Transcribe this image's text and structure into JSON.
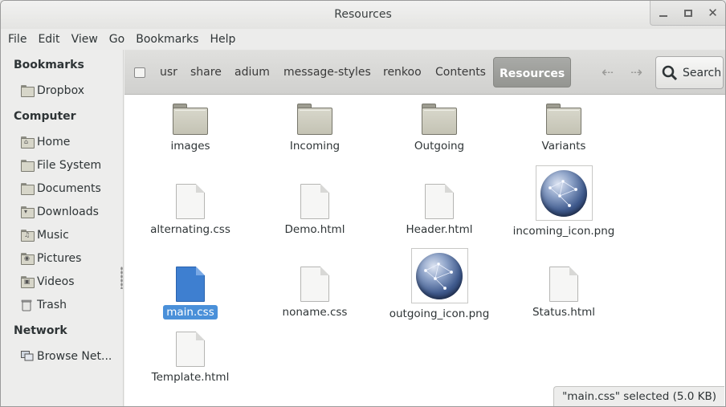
{
  "window": {
    "title": "Resources"
  },
  "menubar": [
    "File",
    "Edit",
    "View",
    "Go",
    "Bookmarks",
    "Help"
  ],
  "sidebar": {
    "sections": [
      {
        "heading": "Bookmarks",
        "items": [
          {
            "label": "Dropbox",
            "icon": "folder-icon"
          }
        ]
      },
      {
        "heading": "Computer",
        "items": [
          {
            "label": "Home",
            "icon": "home-icon"
          },
          {
            "label": "File System",
            "icon": "filesystem-icon"
          },
          {
            "label": "Documents",
            "icon": "documents-icon"
          },
          {
            "label": "Downloads",
            "icon": "downloads-icon"
          },
          {
            "label": "Music",
            "icon": "music-icon"
          },
          {
            "label": "Pictures",
            "icon": "pictures-icon"
          },
          {
            "label": "Videos",
            "icon": "videos-icon"
          },
          {
            "label": "Trash",
            "icon": "trash-icon"
          }
        ]
      },
      {
        "heading": "Network",
        "items": [
          {
            "label": "Browse Net...",
            "icon": "network-icon"
          }
        ]
      }
    ]
  },
  "pathbar": {
    "crumbs": [
      "usr",
      "share",
      "adium",
      "message-styles",
      "renkoo",
      "Contents",
      "Resources"
    ],
    "active": "Resources",
    "search_label": "Search"
  },
  "files": [
    {
      "name": "images",
      "type": "folder"
    },
    {
      "name": "Incoming",
      "type": "folder"
    },
    {
      "name": "Outgoing",
      "type": "folder"
    },
    {
      "name": "Variants",
      "type": "folder"
    },
    {
      "name": "alternating.css",
      "type": "document"
    },
    {
      "name": "Demo.html",
      "type": "document"
    },
    {
      "name": "Header.html",
      "type": "document"
    },
    {
      "name": "incoming_icon.png",
      "type": "image"
    },
    {
      "name": "main.css",
      "type": "document",
      "selected": true
    },
    {
      "name": "noname.css",
      "type": "document"
    },
    {
      "name": "outgoing_icon.png",
      "type": "image"
    },
    {
      "name": "Status.html",
      "type": "document"
    },
    {
      "name": "Template.html",
      "type": "document"
    }
  ],
  "status": {
    "text": "\"main.css\" selected (5.0 KB)"
  },
  "colors": {
    "selection": "#4a90d9",
    "active_crumb": "#9e9f9b"
  }
}
